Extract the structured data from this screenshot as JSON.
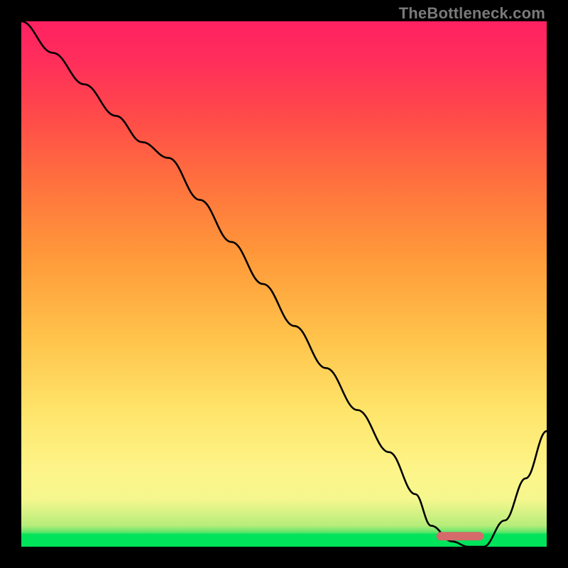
{
  "watermark": "TheBottleneck.com",
  "colors": {
    "gradient_top": "#ff2162",
    "gradient_mid_high": "#ff6f3e",
    "gradient_mid": "#ffe46a",
    "gradient_low": "#f5f78e",
    "gradient_bottom": "#00e35a",
    "curve": "#000000",
    "marker": "#d46a6a",
    "frame_bg": "#000000"
  },
  "chart_data": {
    "type": "line",
    "title": "",
    "xlabel": "",
    "ylabel": "",
    "xlim": [
      0,
      100
    ],
    "ylim": [
      0,
      100
    ],
    "grid": false,
    "series": [
      {
        "name": "curve",
        "x": [
          0,
          6,
          12,
          18,
          23,
          28,
          34,
          40,
          46,
          52,
          58,
          64,
          70,
          75,
          78,
          82,
          85,
          88,
          92,
          96,
          100
        ],
        "values": [
          100,
          94,
          88,
          82,
          77,
          74,
          66,
          58,
          50,
          42,
          34,
          26,
          18,
          10,
          4,
          1,
          0,
          0,
          5,
          13,
          22
        ]
      }
    ],
    "marker": {
      "name": "optimal-range",
      "x_start": 79,
      "x_end": 88,
      "y": 1.2,
      "width_pct": 9,
      "height_pct": 1.6
    }
  }
}
